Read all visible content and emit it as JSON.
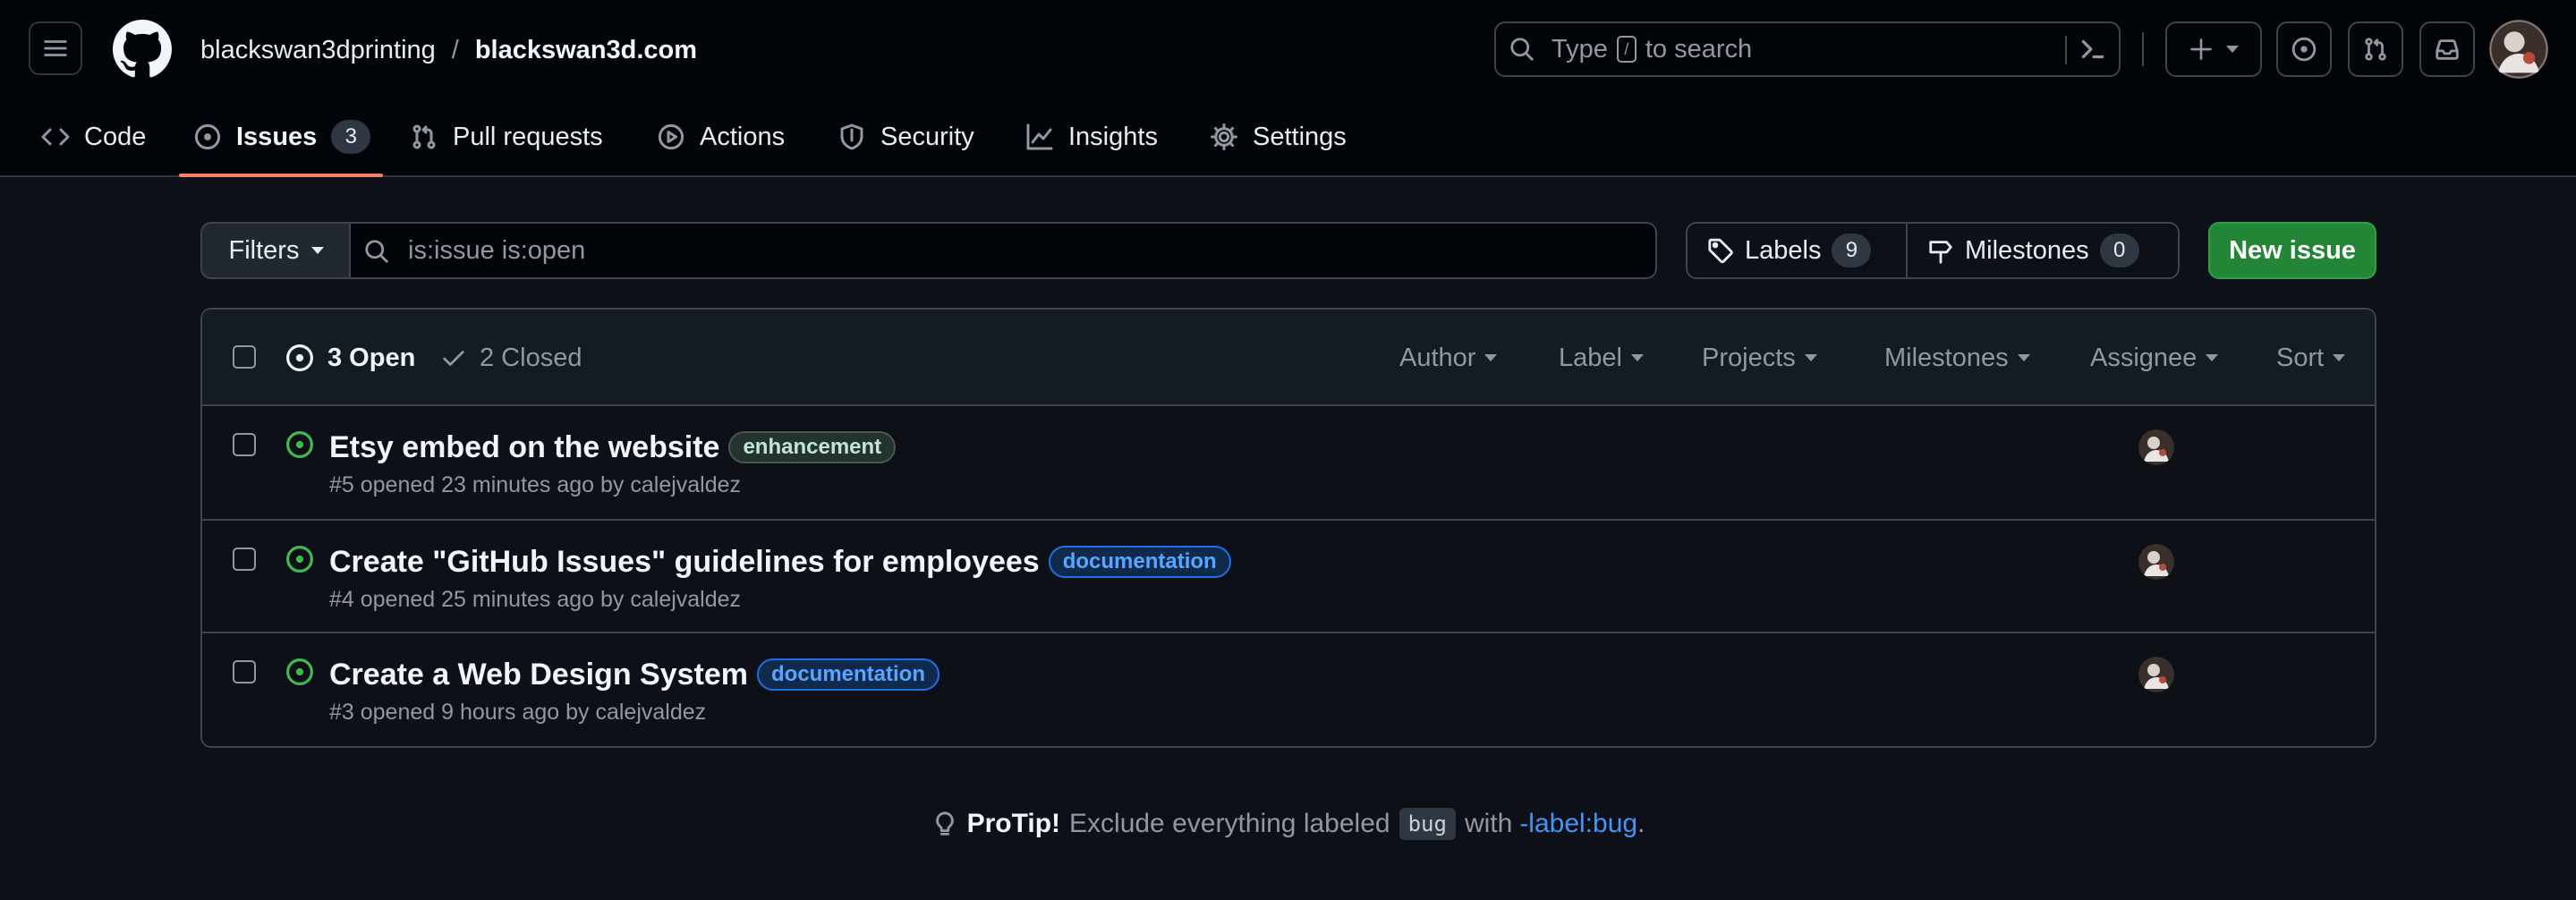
{
  "header": {
    "owner": "blackswan3dprinting",
    "separator": "/",
    "repo": "blackswan3d.com",
    "search": {
      "prefix": "Type",
      "key": "/",
      "suffix": "to search"
    },
    "icons": [
      "hamburger-icon",
      "github-logo-icon",
      "search-icon",
      "command-palette-icon",
      "plus-icon",
      "caret-down-icon",
      "issue-opened-icon",
      "git-pull-request-icon",
      "inbox-icon"
    ]
  },
  "repo_tabs": [
    {
      "label": "Code",
      "icon": "code-icon"
    },
    {
      "label": "Issues",
      "icon": "issue-opened-icon",
      "count": "3",
      "active": true
    },
    {
      "label": "Pull requests",
      "icon": "git-pull-request-icon"
    },
    {
      "label": "Actions",
      "icon": "play-icon"
    },
    {
      "label": "Security",
      "icon": "shield-icon"
    },
    {
      "label": "Insights",
      "icon": "graph-icon"
    },
    {
      "label": "Settings",
      "icon": "gear-icon"
    }
  ],
  "toolbar": {
    "filters_label": "Filters",
    "filter_query": "is:issue is:open",
    "labels_label": "Labels",
    "labels_count": "9",
    "milestones_label": "Milestones",
    "milestones_count": "0",
    "new_issue_label": "New issue"
  },
  "list_header": {
    "open_label": "3 Open",
    "closed_label": "2 Closed",
    "filters": [
      "Author",
      "Label",
      "Projects",
      "Milestones",
      "Assignee",
      "Sort"
    ]
  },
  "issues": [
    {
      "title": "Etsy embed on the website",
      "label": "enhancement",
      "meta": "#5 opened 23 minutes ago by calejvaldez"
    },
    {
      "title": "Create \"GitHub Issues\" guidelines for employees",
      "label": "documentation",
      "meta": "#4 opened 25 minutes ago by calejvaldez"
    },
    {
      "title": "Create a Web Design System",
      "label": "documentation",
      "meta": "#3 opened 9 hours ago by calejvaldez"
    }
  ],
  "protip": {
    "lead": "ProTip!",
    "text1": "Exclude everything labeled",
    "code": "bug",
    "text2": "with",
    "link": "-label:bug",
    "end": "."
  },
  "colors": {
    "background": "#0d1117",
    "header_bg": "#010409",
    "open_green": "#3fb950",
    "primary_button": "#238636",
    "active_tab_underline": "#f78166",
    "link_blue": "#4493f8"
  }
}
